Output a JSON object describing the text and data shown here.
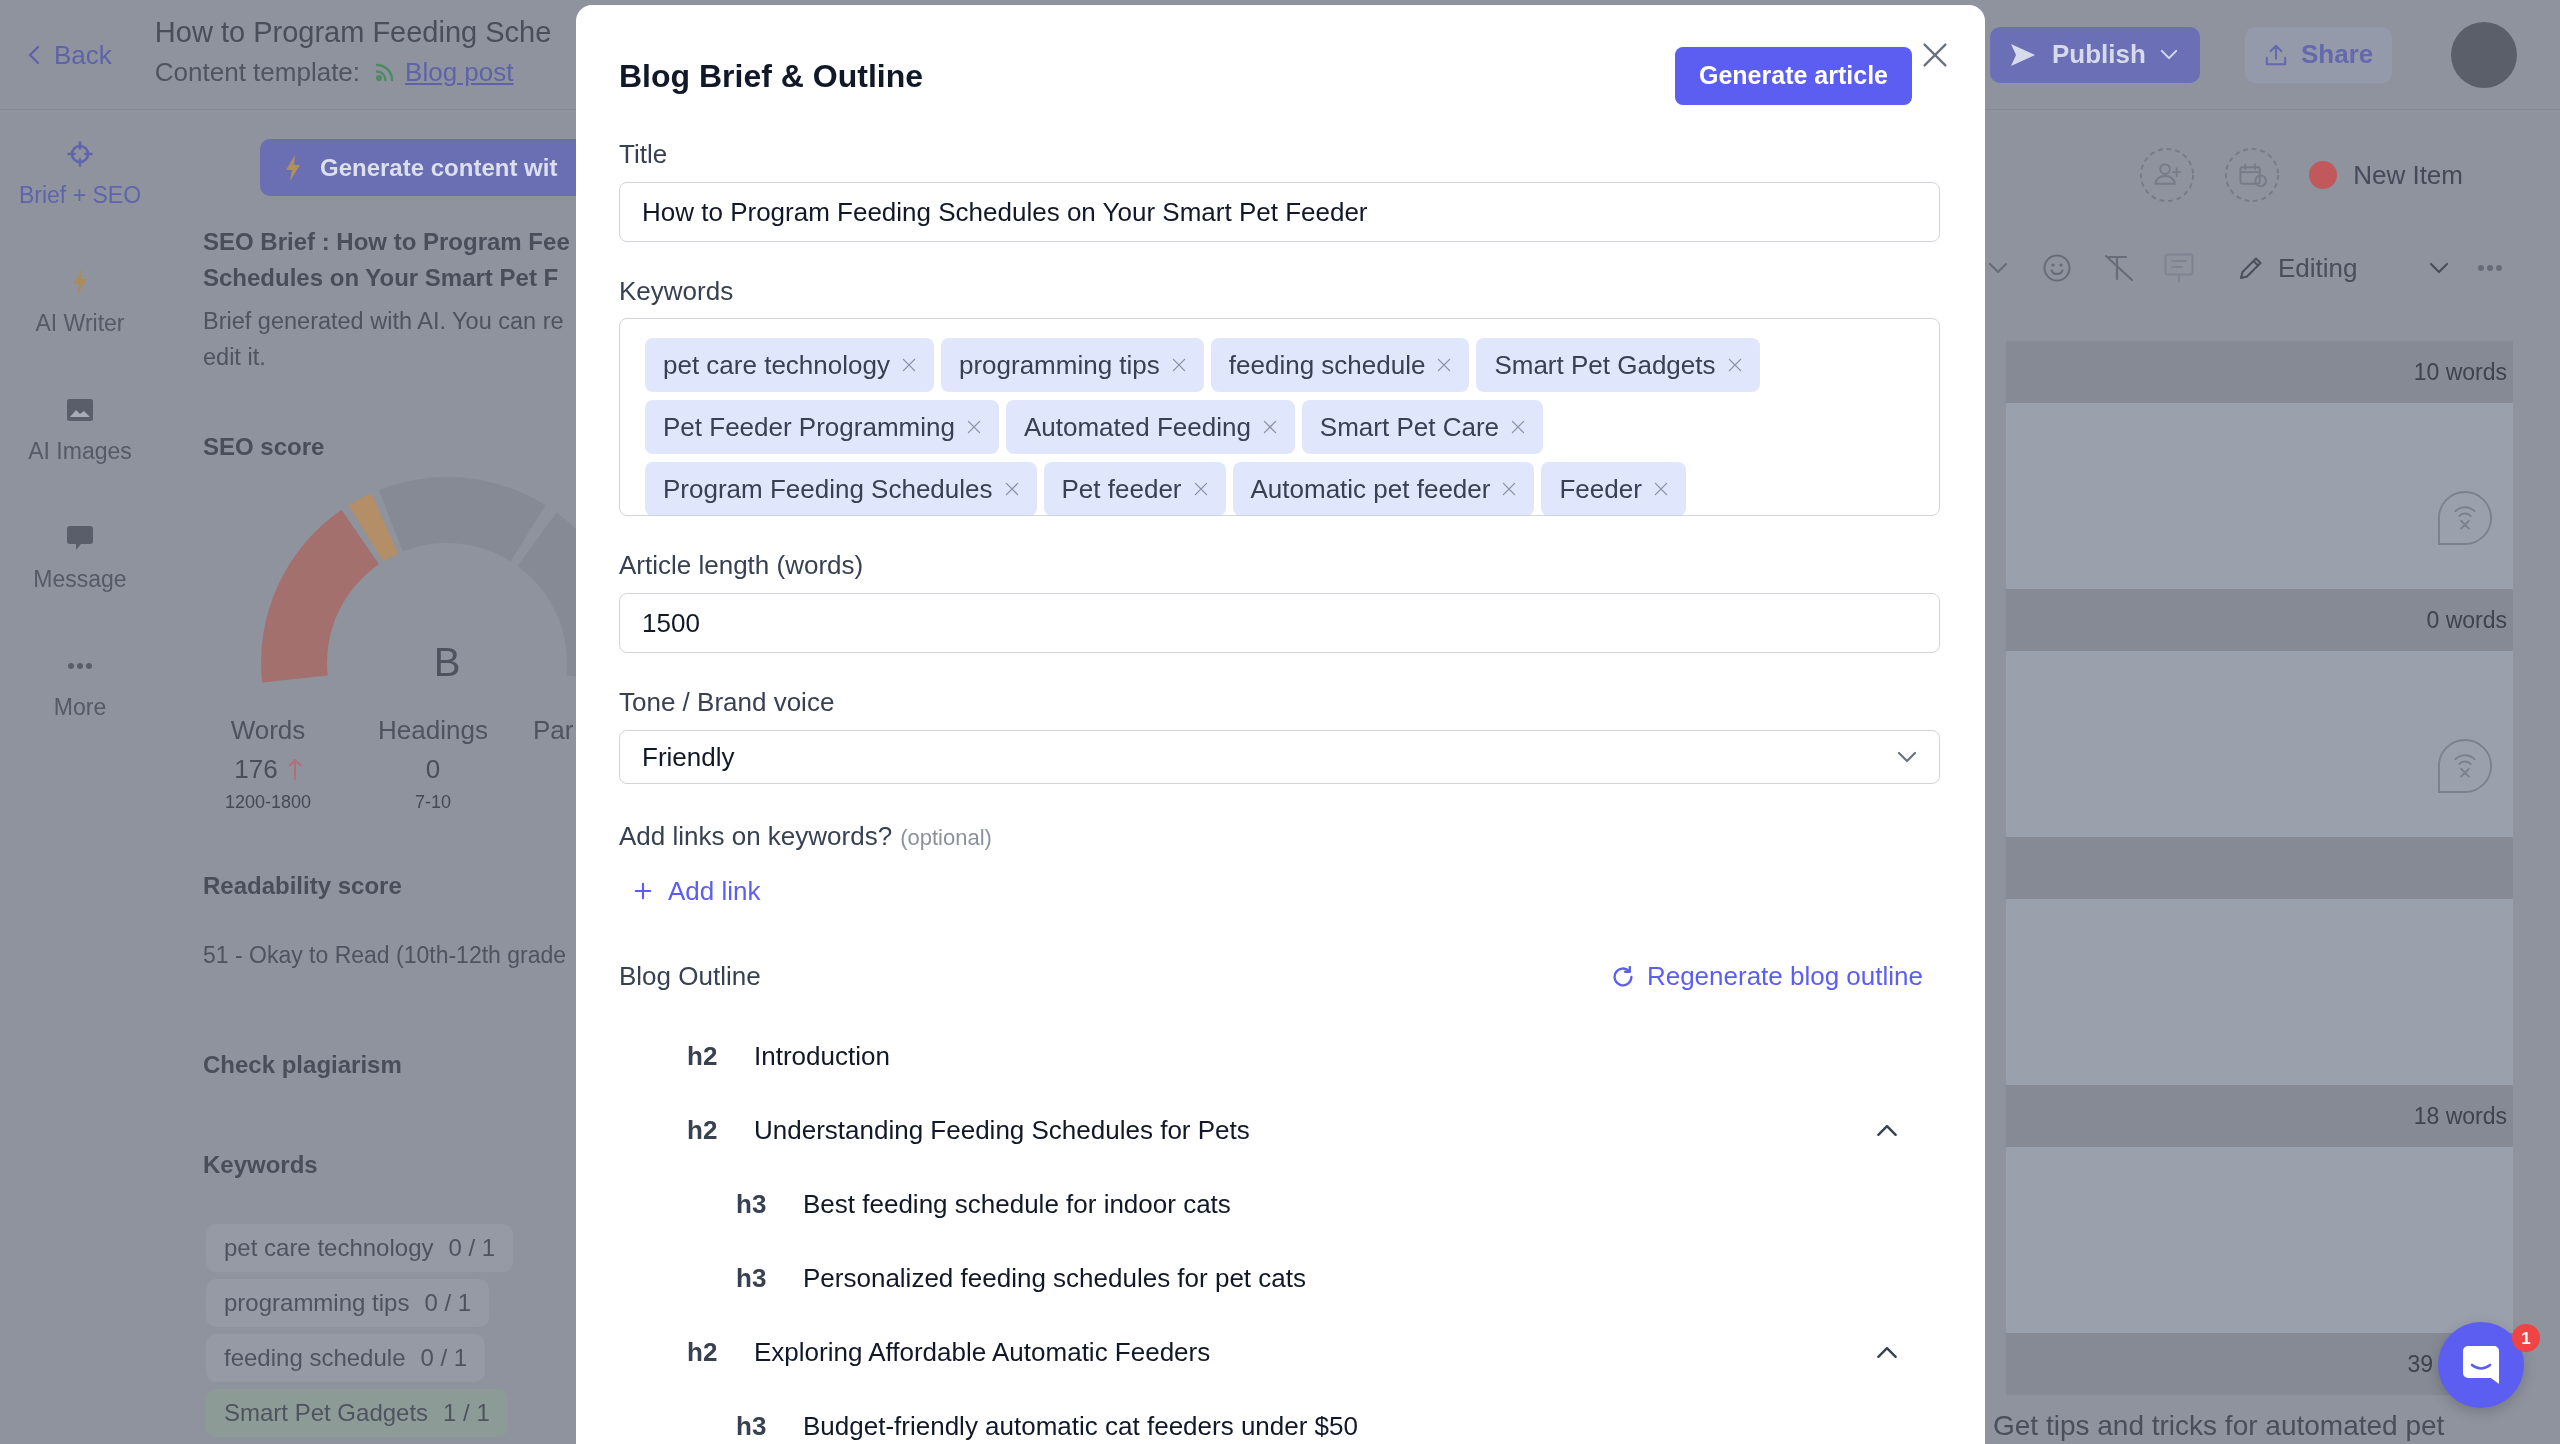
{
  "header": {
    "back": "Back",
    "title": "How to Program Feeding Sche",
    "template_label": "Content template:",
    "template": "Blog post"
  },
  "sidebar": {
    "items": [
      {
        "label": "Brief + SEO",
        "selected": true
      },
      {
        "label": "AI Writer",
        "selected": false
      },
      {
        "label": "AI Images",
        "selected": false
      },
      {
        "label": "Message",
        "selected": false
      },
      {
        "label": "More",
        "selected": false
      }
    ]
  },
  "brief_panel": {
    "generate_button": "Generate content wit",
    "title": "SEO Brief : How to Program Fee\nSchedules on Your Smart Pet F",
    "note": "Brief generated with AI. You can re\nedit it.",
    "seo_score": {
      "heading": "SEO score",
      "grade": "B",
      "level": 0.32,
      "stats": [
        {
          "label": "Words",
          "value": "176",
          "rising": true,
          "range": "1200-1800"
        },
        {
          "label": "Headings",
          "value": "0",
          "rising": false,
          "range": "7-10"
        },
        {
          "label": "Par"
        }
      ]
    },
    "readability": {
      "heading": "Readability score",
      "value": "51 - Okay to Read (10th-12th grade"
    },
    "plagiarism": {
      "heading": "Check plagiarism"
    },
    "keywords": {
      "heading": "Keywords",
      "items": [
        {
          "term": "pet care technology",
          "count": "0 / 1",
          "met": false
        },
        {
          "term": "programming tips",
          "count": "0 / 1",
          "met": false
        },
        {
          "term": "feeding schedule",
          "count": "0 / 1",
          "met": false
        },
        {
          "term": "Smart Pet Gadgets",
          "count": "1 / 1",
          "met": true
        }
      ]
    }
  },
  "dialog": {
    "title": "Blog Brief & Outline",
    "primary_action": "Generate article",
    "fields": [
      {
        "kind": "text",
        "label": "Title",
        "value": "How to Program Feeding Schedules on Your Smart Pet Feeder"
      },
      {
        "kind": "tags",
        "label": "Keywords",
        "tags": [
          "pet care technology",
          "programming tips",
          "feeding schedule",
          "Smart Pet Gadgets",
          "Pet Feeder Programming",
          "Automated Feeding",
          "Smart Pet Care",
          "Program Feeding Schedules",
          "Pet feeder",
          "Automatic pet feeder",
          "Feeder"
        ]
      },
      {
        "kind": "text",
        "label": "Article length (words)",
        "value": "1500"
      },
      {
        "kind": "select",
        "label": "Tone / Brand voice",
        "value": "Friendly"
      },
      {
        "kind": "links",
        "label": "Add links on keywords?",
        "hint": "(optional)",
        "action": "Add link"
      }
    ],
    "outline": {
      "heading": "Blog Outline",
      "action": "Regenerate blog outline",
      "items": [
        {
          "tag": "h2",
          "text": "Introduction"
        },
        {
          "tag": "h2",
          "text": "Understanding Feeding Schedules for Pets",
          "expanded": true,
          "children": [
            {
              "tag": "h3",
              "text": "Best feeding schedule for indoor cats"
            },
            {
              "tag": "h3",
              "text": "Personalized feeding schedules for pet cats"
            }
          ]
        },
        {
          "tag": "h2",
          "text": "Exploring Affordable Automatic Feeders",
          "expanded": true,
          "children": [
            {
              "tag": "h3",
              "text": "Budget-friendly automatic cat feeders under $50"
            }
          ]
        }
      ]
    }
  },
  "top_actions": {
    "publish": "Publish",
    "share": "Share"
  },
  "item_bar": {
    "label": "New Item"
  },
  "editor": {
    "mode": "Editing",
    "blocks": [
      {
        "kind": "count",
        "text": "10 words"
      },
      {
        "kind": "comment"
      },
      {
        "kind": "count",
        "text": "0 words"
      },
      {
        "kind": "comment"
      },
      {
        "kind": "count"
      },
      {
        "kind": "empty"
      },
      {
        "kind": "count",
        "text": "18 words"
      },
      {
        "kind": "empty"
      },
      {
        "kind": "count",
        "text": "39"
      }
    ],
    "paragraph": "Get tips and tricks for automated pet"
  },
  "chat": {
    "badge": "1"
  }
}
